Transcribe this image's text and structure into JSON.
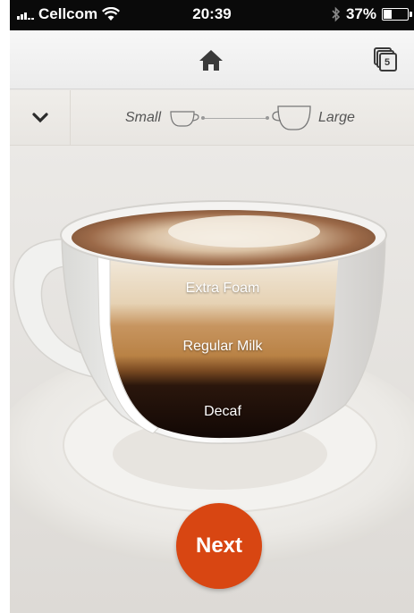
{
  "status_bar": {
    "carrier": "Cellcom",
    "time": "20:39",
    "battery_percent": "37%",
    "battery_level": 0.37
  },
  "nav": {
    "home_icon": "home-icon",
    "cups_icon": "cup-stack-icon",
    "cups_count": "5"
  },
  "size_selector": {
    "small_label": "Small",
    "large_label": "Large"
  },
  "layers": {
    "top": "Extra Foam",
    "middle": "Regular Milk",
    "bottom": "Decaf"
  },
  "next_button": {
    "label": "Next"
  },
  "colors": {
    "accent": "#d84612",
    "espresso": "#1c0f09",
    "milk": "#c79560",
    "foam": "#eee0c8"
  }
}
